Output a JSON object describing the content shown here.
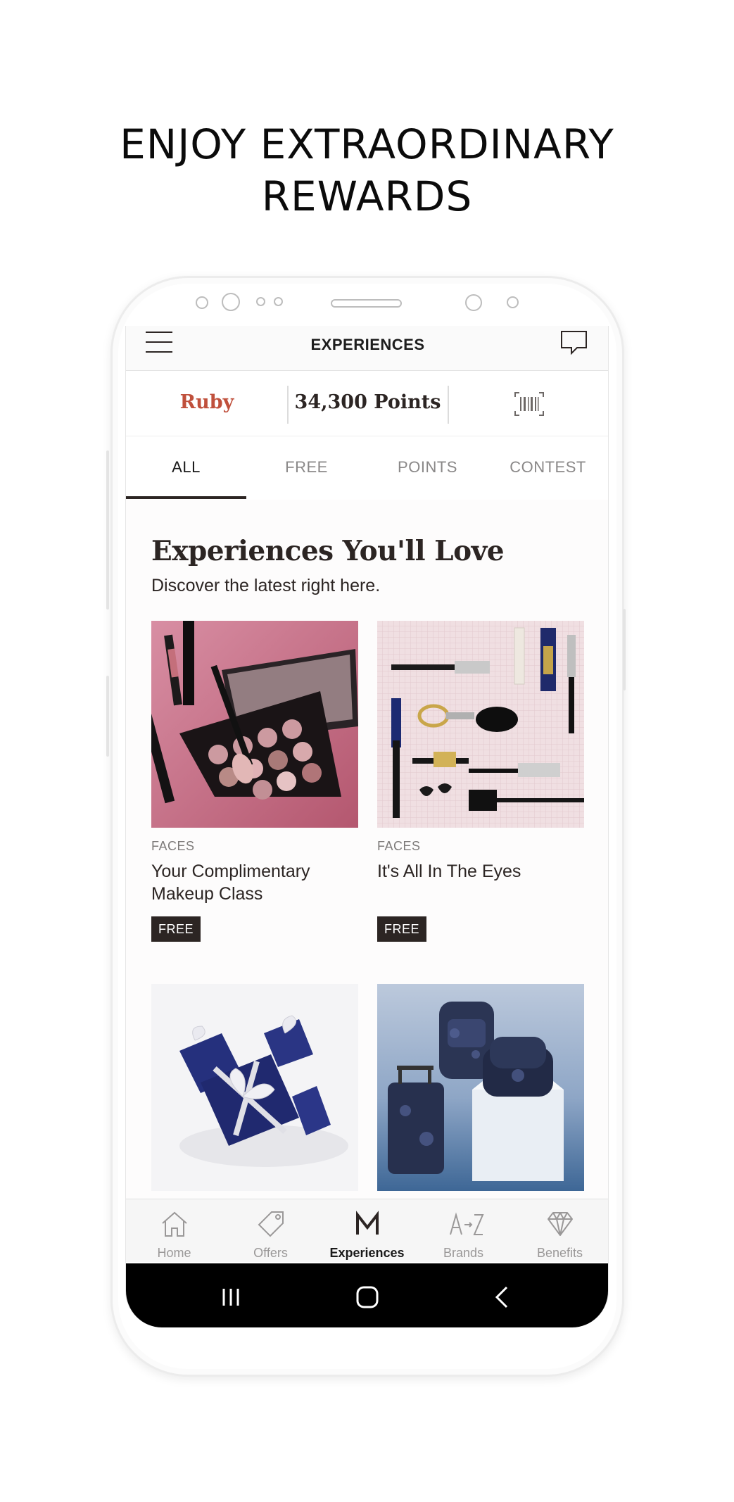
{
  "headline": {
    "line1": "ENJOY EXTRAORDINARY",
    "line2": "REWARDS"
  },
  "appbar": {
    "title": "EXPERIENCES"
  },
  "membership": {
    "tier": "Ruby",
    "points": "34,300 Points"
  },
  "tabs": [
    {
      "label": "ALL",
      "active": true
    },
    {
      "label": "FREE",
      "active": false
    },
    {
      "label": "POINTS",
      "active": false
    },
    {
      "label": "CONTEST",
      "active": false
    }
  ],
  "section": {
    "title": "Experiences You'll Love",
    "subtitle": "Discover the latest right here."
  },
  "cards": [
    {
      "category": "FACES",
      "title": "Your Complimentary Makeup Class",
      "badge": "FREE",
      "image": "eyeshadow-palette-image"
    },
    {
      "category": "FACES",
      "title": "It's All In The Eyes",
      "badge": "FREE",
      "image": "mascara-lash-products-image"
    },
    {
      "category": "",
      "title": "",
      "badge": "",
      "image": "gift-boxes-image"
    },
    {
      "category": "",
      "title": "",
      "badge": "",
      "image": "luggage-backpacks-image"
    }
  ],
  "bottom_nav": [
    {
      "label": "Home",
      "icon": "home-icon",
      "active": false
    },
    {
      "label": "Offers",
      "icon": "tag-icon",
      "active": false
    },
    {
      "label": "Experiences",
      "icon": "m-logo-icon",
      "active": true
    },
    {
      "label": "Brands",
      "icon": "a-to-z-icon",
      "active": false
    },
    {
      "label": "Benefits",
      "icon": "diamond-icon",
      "active": false
    }
  ],
  "colors": {
    "accent_tier": "#c0503c",
    "dark": "#2c2523",
    "muted": "#8a8888"
  }
}
